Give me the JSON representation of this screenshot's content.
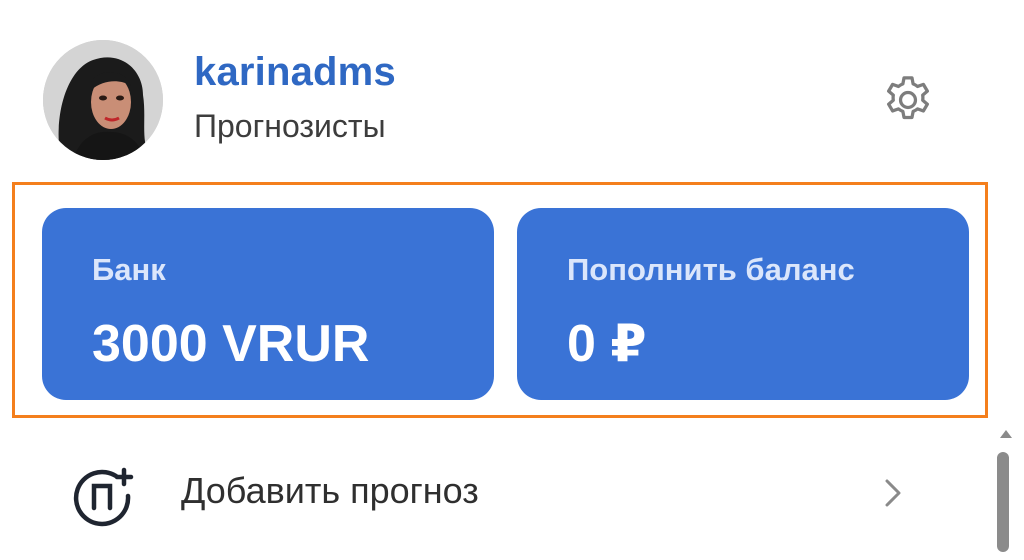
{
  "profile": {
    "username": "karinadms",
    "role": "Прогнозисты",
    "settings_icon": "gear-icon"
  },
  "balance": {
    "bank": {
      "label": "Банк",
      "value": "3000 VRUR"
    },
    "topup": {
      "label": "Пополнить баланс",
      "value": "0 ₽"
    }
  },
  "actions": {
    "add_forecast": {
      "label": "Добавить прогноз",
      "icon": "add-forecast-icon"
    }
  },
  "colors": {
    "accent": "#3a73d6",
    "username": "#2f68c3",
    "highlight": "#f47f1c"
  }
}
